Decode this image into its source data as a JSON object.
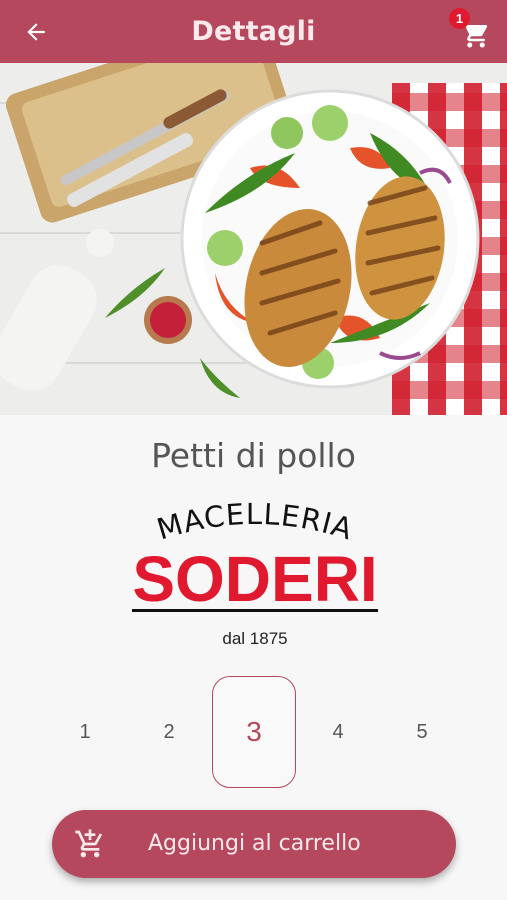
{
  "appbar": {
    "title": "Dettagli",
    "back_icon": "arrow-left-icon",
    "cart_icon": "shopping-cart-icon",
    "cart_count": "1",
    "color": "#b5485c"
  },
  "product": {
    "name": "Petti di pollo",
    "image": "grilled-chicken-salad-plate"
  },
  "brand": {
    "line1": "MACELLERIA",
    "line2": "SODERI",
    "since": "dal 1875",
    "accent": "#e0192f"
  },
  "quantity": {
    "options": [
      "1",
      "2",
      "3",
      "4",
      "5"
    ],
    "selected": "3"
  },
  "add_to_cart": {
    "label": "Aggiungi al carrello",
    "icon": "cart-plus-icon"
  }
}
